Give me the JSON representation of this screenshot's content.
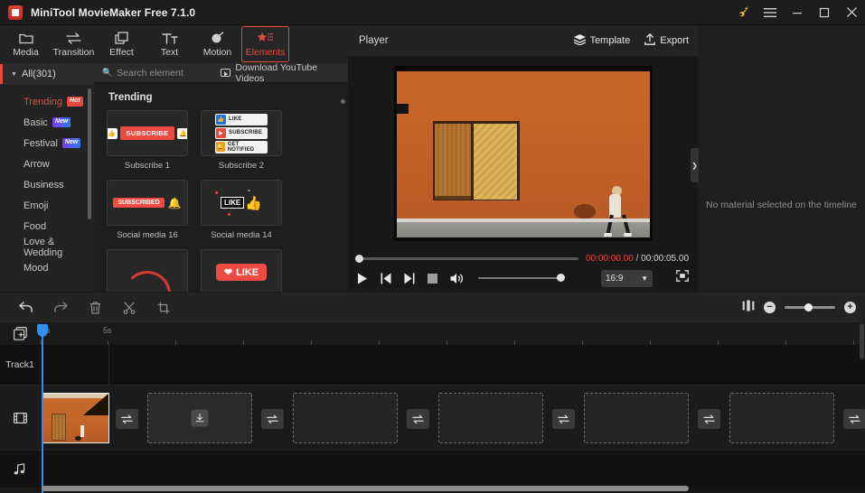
{
  "window": {
    "title": "MiniTool MovieMaker Free 7.1.0",
    "controls": {
      "key": "key-icon",
      "menu": "menu-icon",
      "minimize": "–",
      "maximize": "□",
      "close": "✕"
    }
  },
  "toolbar": {
    "items": [
      {
        "label": "Media",
        "icon": "folder-icon",
        "active": false
      },
      {
        "label": "Transition",
        "icon": "transition-icon",
        "active": false
      },
      {
        "label": "Effect",
        "icon": "effect-icon",
        "active": false
      },
      {
        "label": "Text",
        "icon": "text-icon",
        "active": false
      },
      {
        "label": "Motion",
        "icon": "motion-icon",
        "active": false
      },
      {
        "label": "Elements",
        "icon": "elements-icon",
        "active": true
      }
    ],
    "active_accent": "#e8493c"
  },
  "categories": {
    "all_label": "All(301)",
    "items": [
      {
        "label": "Trending",
        "badge": "Hot",
        "badge_type": "hot",
        "selected": true
      },
      {
        "label": "Basic",
        "badge": "New",
        "badge_type": "new",
        "selected": false
      },
      {
        "label": "Festival",
        "badge": "New",
        "badge_type": "new",
        "selected": false
      },
      {
        "label": "Arrow",
        "badge": "",
        "badge_type": "",
        "selected": false
      },
      {
        "label": "Business",
        "badge": "",
        "badge_type": "",
        "selected": false
      },
      {
        "label": "Emoji",
        "badge": "",
        "badge_type": "",
        "selected": false
      },
      {
        "label": "Food",
        "badge": "",
        "badge_type": "",
        "selected": false
      },
      {
        "label": "Love & Wedding",
        "badge": "",
        "badge_type": "",
        "selected": false
      },
      {
        "label": "Mood",
        "badge": "",
        "badge_type": "",
        "selected": false
      }
    ]
  },
  "browser": {
    "search_placeholder": "Search element",
    "search_value": "",
    "download_label": "Download YouTube Videos",
    "section_title": "Trending",
    "elements": [
      {
        "caption": "Subscribe 1",
        "art": "subscribe1",
        "text": "SUBSCRIBE"
      },
      {
        "caption": "Subscribe 2",
        "art": "subscribe2",
        "rows": [
          "LIKE",
          "SUBSCRIBE",
          "GET NOTIFIED"
        ]
      },
      {
        "caption": "Social media 16",
        "art": "subscribed",
        "text": "SUBSCRIBED"
      },
      {
        "caption": "Social media 14",
        "art": "likeburst",
        "text": "LIKE"
      },
      {
        "caption": "",
        "art": "arc",
        "text": ""
      },
      {
        "caption": "",
        "art": "likepill",
        "text": "LIKE"
      }
    ]
  },
  "player": {
    "title": "Player",
    "template_label": "Template",
    "export_label": "Export",
    "current_time": "00:00:00.00",
    "separator": "/",
    "total_time": "00:00:05.00",
    "aspect_ratio": "16:9",
    "time_accent": "#e8493c"
  },
  "right_panel": {
    "message": "No material selected on the timeline"
  },
  "timeline_toolbar": {
    "buttons": [
      {
        "name": "undo",
        "icon": "undo-icon"
      },
      {
        "name": "redo",
        "icon": "redo-icon"
      },
      {
        "name": "delete",
        "icon": "trash-icon"
      },
      {
        "name": "split",
        "icon": "scissors-icon"
      },
      {
        "name": "crop",
        "icon": "crop-icon"
      }
    ],
    "zoom_fit": "fit-icon",
    "zoom_out": "−",
    "zoom_in": "+"
  },
  "timeline": {
    "ruler_ticks": [
      "0s",
      "5s"
    ],
    "playhead_time": "0s",
    "tracks": [
      {
        "label": "Track1",
        "type": "text"
      },
      {
        "label": "",
        "type": "video",
        "icon": "film-icon"
      },
      {
        "label": "",
        "type": "audio",
        "icon": "music-icon"
      }
    ],
    "add_track_icon": "add-media-icon",
    "clips": [
      {
        "type": "video-clip",
        "label": ""
      }
    ],
    "transitions": 5,
    "placeholders": 4
  }
}
